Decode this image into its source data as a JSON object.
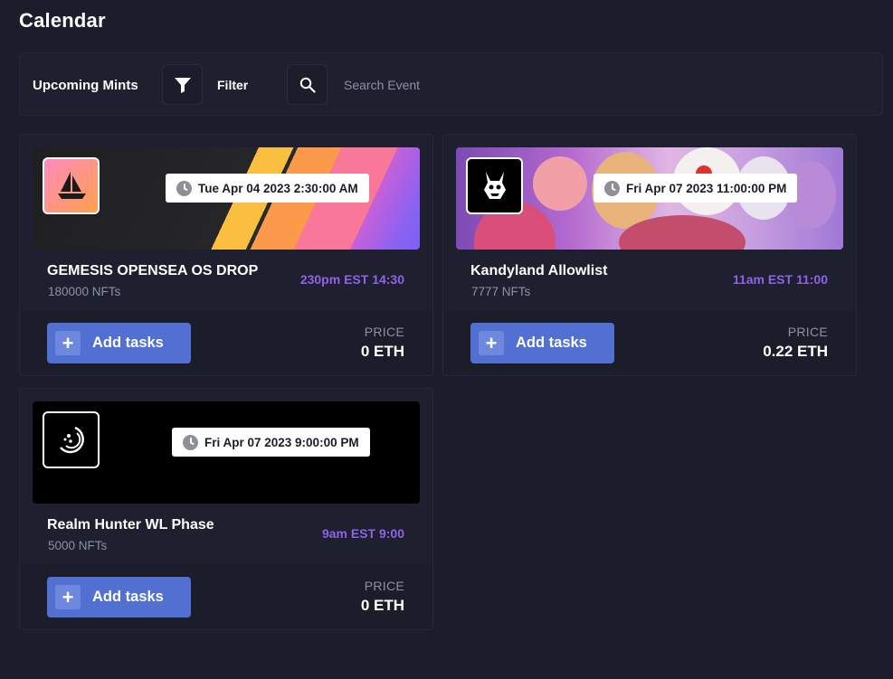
{
  "page": {
    "title": "Calendar"
  },
  "toolbar": {
    "section_label": "Upcoming Mints",
    "filter_label": "Filter",
    "search_placeholder": "Search Event",
    "filter_icon": "filter-funnel-icon",
    "search_icon": "search-icon"
  },
  "colors": {
    "background": "#1b1d2b",
    "card": "#1e2030",
    "accent_button": "#5270d2",
    "time_text": "#8e63e6",
    "muted_text": "#8d90a6"
  },
  "events": [
    {
      "name": "GEMESIS OPENSEA OS DROP",
      "count": "180000 NFTs",
      "date": "Tue Apr 04 2023 2:30:00 AM",
      "time": "230pm EST 14:30",
      "button_label": "Add tasks",
      "price_label": "PRICE",
      "price_value": "0 ETH",
      "logo_icon": "opensea-ship-icon"
    },
    {
      "name": "Kandyland Allowlist",
      "count": "7777 NFTs",
      "date": "Fri Apr 07 2023 11:00:00 PM",
      "time": "11am EST 11:00",
      "button_label": "Add tasks",
      "price_label": "PRICE",
      "price_value": "0.22 ETH",
      "logo_icon": "kandyland-rabbit-icon"
    },
    {
      "name": "Realm Hunter WL Phase",
      "count": "5000 NFTs",
      "date": "Fri Apr 07 2023 9:00:00 PM",
      "time": "9am EST 9:00",
      "button_label": "Add tasks",
      "price_label": "PRICE",
      "price_value": "0 ETH",
      "logo_icon": "realm-hunter-emblem-icon"
    }
  ]
}
